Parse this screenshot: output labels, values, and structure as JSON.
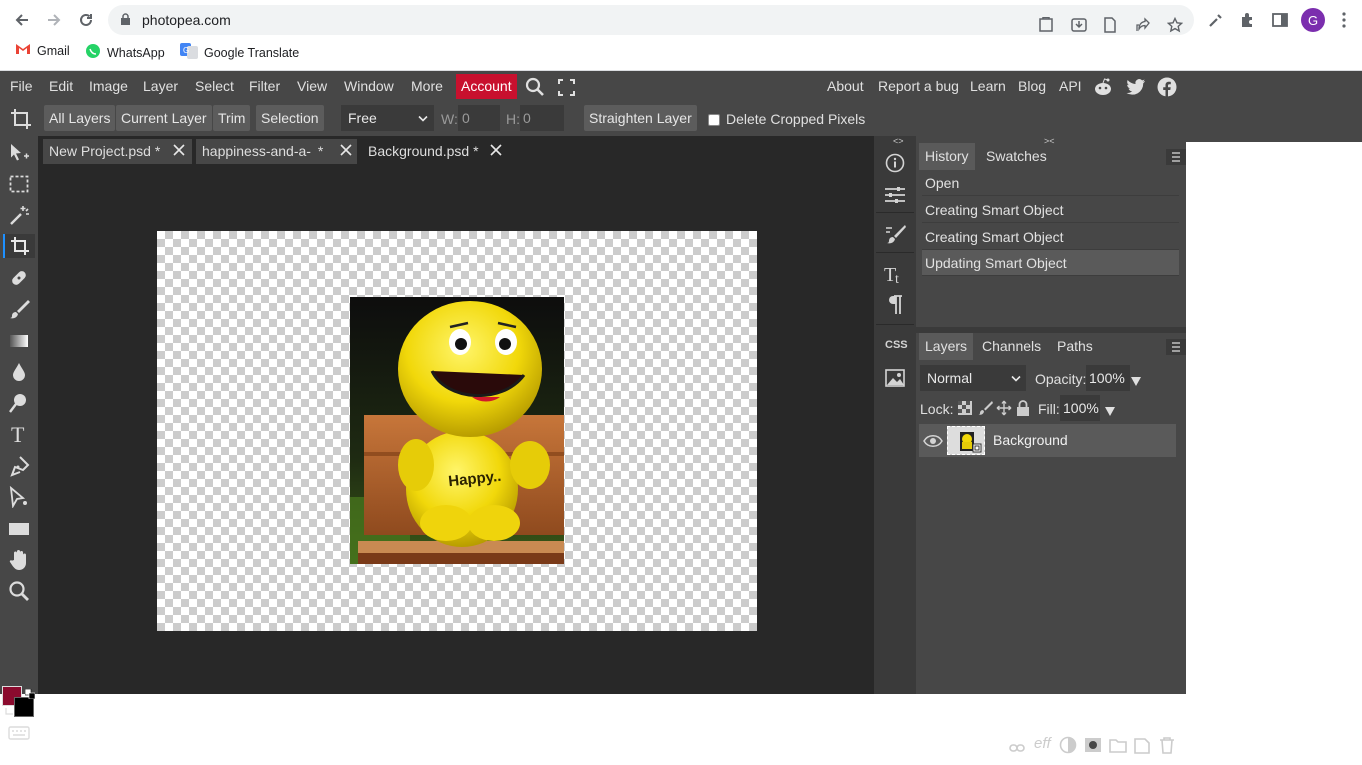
{
  "browser": {
    "url": "photopea.com",
    "profile_initial": "G",
    "bookmarks": [
      "Gmail",
      "WhatsApp",
      "Google Translate"
    ]
  },
  "menubar": {
    "items": [
      "File",
      "Edit",
      "Image",
      "Layer",
      "Select",
      "Filter",
      "View",
      "Window",
      "More"
    ],
    "account": "Account",
    "right_links": [
      "About",
      "Report a bug",
      "Learn",
      "Blog",
      "API"
    ]
  },
  "options": {
    "buttons": [
      "All Layers",
      "Current Layer",
      "Trim",
      "Selection"
    ],
    "ratio": "Free",
    "w_label": "W:",
    "w_value": "0",
    "h_label": "H:",
    "h_value": "0",
    "straighten": "Straighten Layer",
    "delete_cropped": "Delete Cropped Pixels"
  },
  "tabs": [
    {
      "label": "New Project.psd *"
    },
    {
      "label": "happiness-and-a-"
    },
    {
      "label": "Background.psd *"
    }
  ],
  "tab2_suffix": "*",
  "history_panel": {
    "tabs": [
      "History",
      "Swatches"
    ],
    "rows": [
      "Open",
      "Creating Smart Object",
      "Creating Smart Object",
      "Updating Smart Object"
    ]
  },
  "layers_panel": {
    "tabs": [
      "Layers",
      "Channels",
      "Paths"
    ],
    "blend_mode": "Normal",
    "opacity_label": "Opacity:",
    "opacity": "100%",
    "lock_label": "Lock:",
    "fill_label": "Fill:",
    "fill": "100%",
    "layer_name": "Background",
    "footer_eff": "eff"
  },
  "iconcol": {
    "css_label": "CSS"
  },
  "photo": {
    "shirt_text": "Happy.."
  },
  "colors": {
    "foreground": "#8b0b2e",
    "background": "#000000",
    "accent": "#c8102e"
  }
}
